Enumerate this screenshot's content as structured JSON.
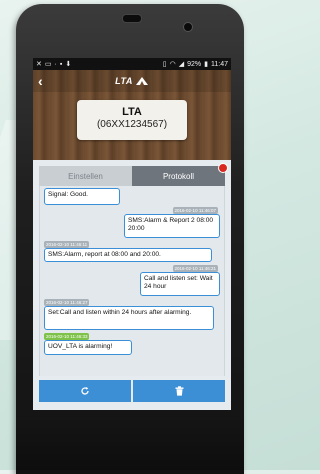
{
  "status_bar": {
    "battery": "92%",
    "time": "11:47"
  },
  "header": {
    "logo": "LTA",
    "device_name": "LTA",
    "device_number": "(06XX1234567)"
  },
  "tabs": [
    {
      "label": "Einstellen",
      "active": false
    },
    {
      "label": "Protokoll",
      "active": true
    }
  ],
  "messages": [
    {
      "direction": "in",
      "text": "Signal: Good.",
      "timestamp": ""
    },
    {
      "direction": "out",
      "timestamp": "2016-02-10 11:46:07",
      "text": "SMS:Alarm & Report 2 08:00 20:00"
    },
    {
      "direction": "in",
      "timestamp": "2016-02-10 11:46:11",
      "text": "SMS:Alarm, report at 08:00 and 20:00."
    },
    {
      "direction": "out",
      "timestamp": "2016-02-10 11:46:21",
      "text": "Call and listen set: Wait 24 hour"
    },
    {
      "direction": "in",
      "timestamp": "2016-02-10 11:46:27",
      "text": "Set:Call and listen within 24 hours after alarming."
    },
    {
      "direction": "in",
      "timestamp": "2016-02-10 11:46:33",
      "text": "UOV_LTA is alarming!"
    }
  ],
  "buttons": {
    "refresh_icon": "refresh-icon",
    "delete_icon": "trash-icon"
  },
  "colors": {
    "accent": "#3d8fd5",
    "bubble_border": "#3a8fd6",
    "new_marker": "#7fc24a",
    "alert_dot": "#d8281f"
  }
}
